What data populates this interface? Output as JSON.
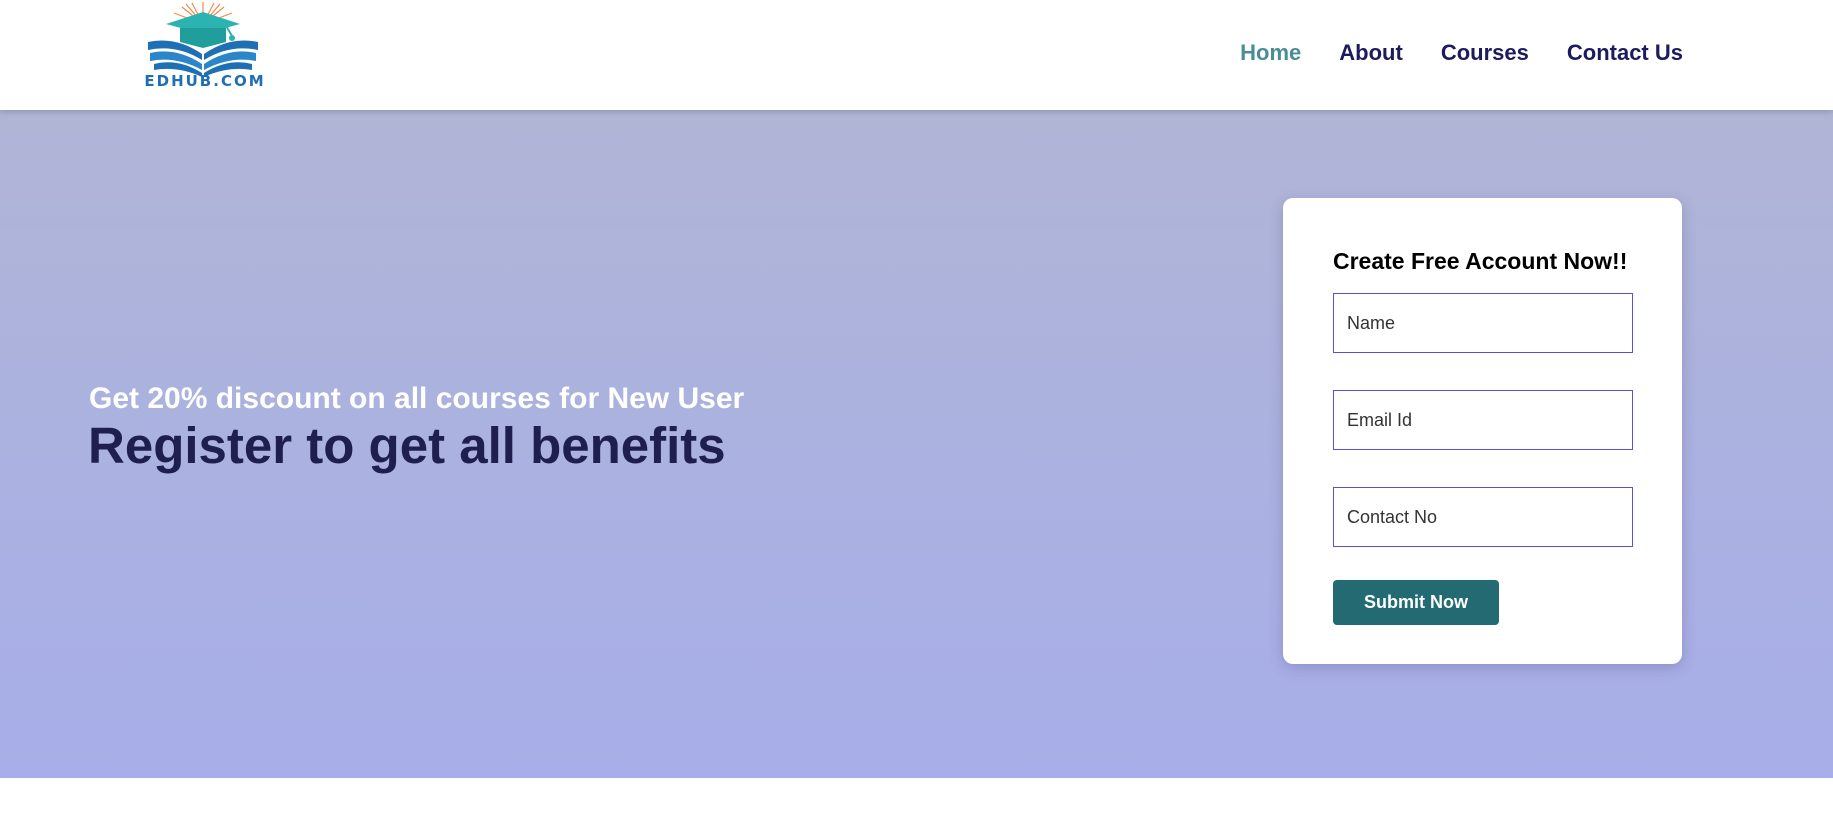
{
  "brand": {
    "name": "EDHUB.COM",
    "colors": {
      "primary": "#1e6fb3",
      "accent": "#2bb3b1",
      "rays": "#f08a4b"
    }
  },
  "nav": {
    "items": [
      {
        "label": "Home",
        "active": true
      },
      {
        "label": "About",
        "active": false
      },
      {
        "label": "Courses",
        "active": false
      },
      {
        "label": "Contact Us",
        "active": false
      }
    ],
    "active_color": "#4a8d97",
    "color": "#1b1b5e"
  },
  "hero": {
    "subtitle": "Get 20% discount on all courses for New User",
    "title": "Register to get all benefits"
  },
  "form": {
    "title": "Create Free Account Now!!",
    "fields": {
      "name": {
        "placeholder": "Name",
        "value": ""
      },
      "email": {
        "placeholder": "Email Id",
        "value": ""
      },
      "contact": {
        "placeholder": "Contact No",
        "value": ""
      }
    },
    "submit_label": "Submit Now",
    "button_color": "#236a73"
  }
}
